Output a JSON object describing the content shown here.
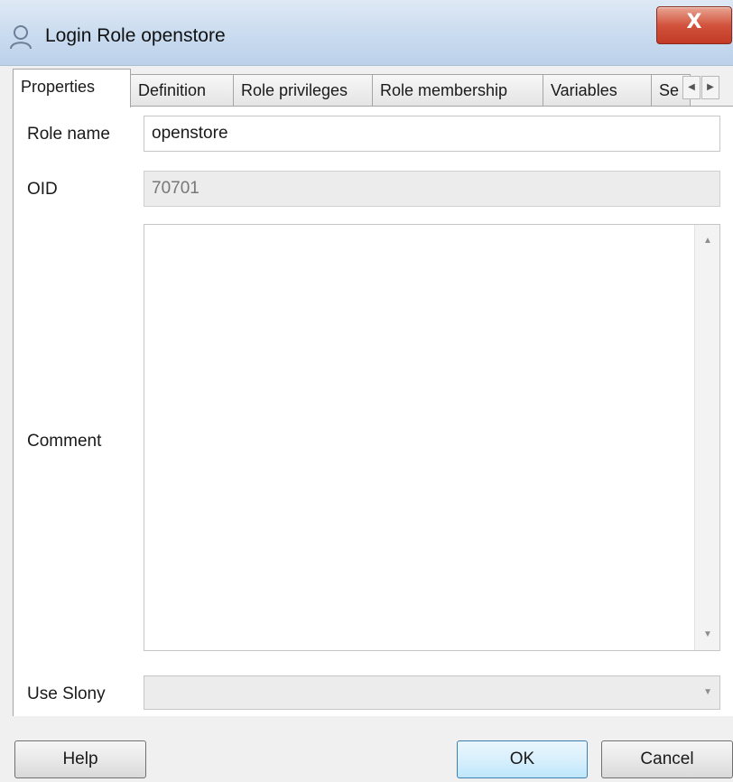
{
  "window": {
    "title": "Login Role openstore",
    "close_glyph": "X",
    "icon": "user-icon"
  },
  "tabs": [
    {
      "label": "Properties",
      "active": true
    },
    {
      "label": "Definition",
      "active": false
    },
    {
      "label": "Role privileges",
      "active": false
    },
    {
      "label": "Role membership",
      "active": false
    },
    {
      "label": "Variables",
      "active": false
    },
    {
      "label": "Se",
      "active": false
    }
  ],
  "tab_scroll": {
    "left_glyph": "◀",
    "right_glyph": "▶"
  },
  "form": {
    "role_name_label": "Role name",
    "role_name_value": "openstore",
    "oid_label": "OID",
    "oid_value": "70701",
    "comment_label": "Comment",
    "comment_value": "",
    "use_slony_label": "Use Slony",
    "use_slony_value": ""
  },
  "buttons": {
    "help": "Help",
    "ok": "OK",
    "cancel": "Cancel"
  },
  "colors": {
    "close_button": "#c23a25",
    "default_button_border": "#3c7fb1"
  }
}
